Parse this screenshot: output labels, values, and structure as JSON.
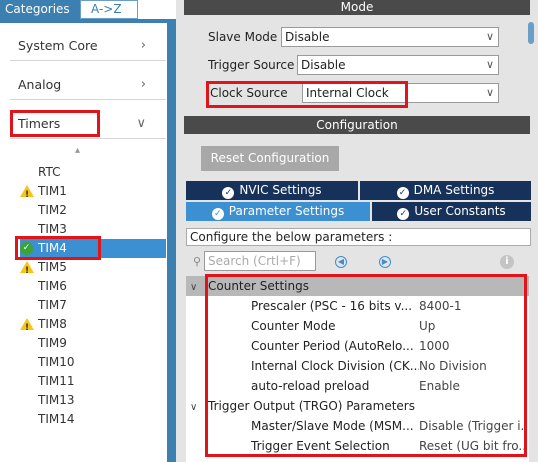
{
  "left": {
    "tabs": {
      "categories": "Categories",
      "az": "A->Z"
    },
    "categories": [
      {
        "label": "System Core",
        "chevron": "›"
      },
      {
        "label": "Analog",
        "chevron": "›"
      },
      {
        "label": "Timers",
        "chevron": "∨"
      }
    ],
    "sort_icon": "▴",
    "timers": [
      {
        "label": "RTC",
        "status": ""
      },
      {
        "label": "TIM1",
        "status": "warning"
      },
      {
        "label": "TIM2",
        "status": ""
      },
      {
        "label": "TIM3",
        "status": ""
      },
      {
        "label": "TIM4",
        "status": "ok"
      },
      {
        "label": "TIM5",
        "status": "warning"
      },
      {
        "label": "TIM6",
        "status": ""
      },
      {
        "label": "TIM7",
        "status": ""
      },
      {
        "label": "TIM8",
        "status": "warning"
      },
      {
        "label": "TIM9",
        "status": ""
      },
      {
        "label": "TIM10",
        "status": ""
      },
      {
        "label": "TIM11",
        "status": ""
      },
      {
        "label": "TIM13",
        "status": ""
      },
      {
        "label": "TIM14",
        "status": ""
      }
    ]
  },
  "mode": {
    "title": "Mode",
    "fields": [
      {
        "label": "Slave Mode",
        "value": "Disable"
      },
      {
        "label": "Trigger Source",
        "value": "Disable"
      },
      {
        "label": "Clock Source",
        "value": "Internal Clock"
      }
    ],
    "dropdown_icon": "∨"
  },
  "configuration": {
    "title": "Configuration",
    "reset_label": "Reset Configuration",
    "tabs": [
      {
        "label": "NVIC Settings"
      },
      {
        "label": "DMA Settings"
      },
      {
        "label": "Parameter Settings"
      },
      {
        "label": "User Constants"
      }
    ],
    "hint": "Configure the below parameters :",
    "search_placeholder": "Search (Crtl+F)",
    "groups": [
      {
        "label": "Counter Settings",
        "params": [
          {
            "name": "Prescaler (PSC - 16 bits v...",
            "value": "8400-1"
          },
          {
            "name": "Counter Mode",
            "value": "Up"
          },
          {
            "name": "Counter Period (AutoRelo...",
            "value": "1000"
          },
          {
            "name": "Internal Clock Division (CK...",
            "value": "No Division"
          },
          {
            "name": "auto-reload preload",
            "value": "Enable"
          }
        ]
      },
      {
        "label": "Trigger Output (TRGO) Parameters",
        "params": [
          {
            "name": "Master/Slave Mode (MSM...",
            "value": "Disable (Trigger i..."
          },
          {
            "name": "Trigger Event Selection",
            "value": "Reset (UG bit fro..."
          }
        ]
      }
    ]
  },
  "colors": {
    "accent": "#3c8fd0",
    "highlight": "#e0141b",
    "dark_tab": "#17325a",
    "warning": "#f5c518",
    "ok": "#3aa33a"
  }
}
